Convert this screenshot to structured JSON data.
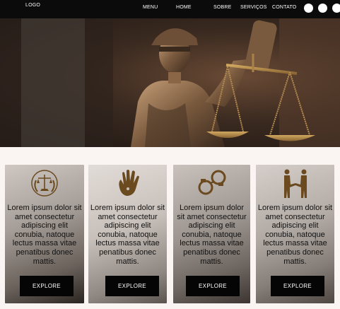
{
  "nav": {
    "logo": "LOGO",
    "links": [
      "MENU",
      "HOME",
      "SOBRE",
      "SERVIÇOS",
      "CONTATO"
    ],
    "social_icons": [
      "social-icon-1",
      "social-icon-2",
      "social-icon-3"
    ]
  },
  "hero": {
    "image": "lady-justice-statue"
  },
  "cards": [
    {
      "icon": "scales-emblem-icon",
      "text": "Lorem ipsum dolor sit amet consectetur adipiscing elit conubia, natoque lectus massa vitae penatibus donec mattis.",
      "button": "EXPLORE"
    },
    {
      "icon": "handprint-icon",
      "text": "Lorem ipsum dolor sit amet consectetur adipiscing elit conubia, natoque lectus massa vitae penatibus donec mattis.",
      "button": "EXPLORE"
    },
    {
      "icon": "handcuffs-icon",
      "text": "Lorem ipsum dolor sit amet consectetur adipiscing elit conubia, natoque lectus massa vitae penatibus donec mattis.",
      "button": "EXPLORE"
    },
    {
      "icon": "handshake-icon",
      "text": "Lorem ipsum dolor sit amet consectetur adipiscing elit conubia, natoque lectus massa vitae penatibus donec mattis.",
      "button": "EXPLORE"
    }
  ],
  "colors": {
    "nav_bg": "#0b0b0b",
    "page_bg": "#faf4f2",
    "icon_brown": "#6b4a1f",
    "button_bg": "#050505"
  }
}
